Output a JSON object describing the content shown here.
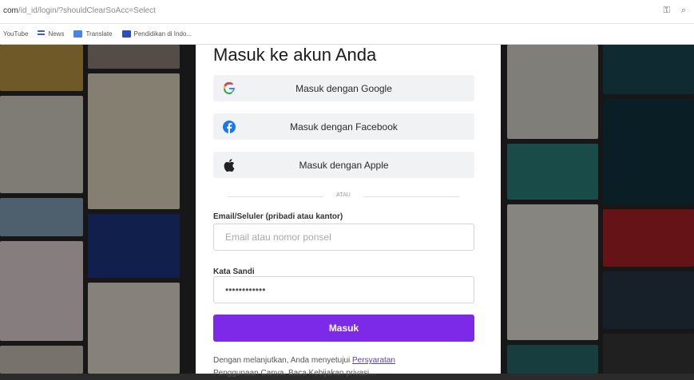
{
  "browser": {
    "url_domain": "com",
    "url_path": "/id_id/login/?shouldClearSoAcc=Select",
    "bookmarks": [
      {
        "icon": "youtube-icon",
        "label": "YouTube"
      },
      {
        "icon": "list-icon",
        "label": "News"
      },
      {
        "icon": "translate-icon",
        "label": "Translate"
      },
      {
        "icon": "ikon-icon",
        "label": "Pendidikan di Indo..."
      }
    ]
  },
  "login": {
    "title": "Masuk ke akun Anda",
    "google_label": "Masuk dengan Google",
    "facebook_label": "Masuk dengan Facebook",
    "apple_label": "Masuk dengan Apple",
    "divider_text": "ATAU",
    "email_label": "Email/Seluler (pribadi atau kantor)",
    "email_placeholder": "Email atau nomor ponsel",
    "password_label": "Kata Sandi",
    "password_value": "••••••••••••",
    "submit_label": "Masuk",
    "terms_prefix": "Dengan melanjutkan, Anda menyetujui ",
    "terms_link": "Persyaratan",
    "terms_suffix": "Penggunaan Canva. Baca Kebijakan privasi..."
  },
  "colors": {
    "accent": "#7d2ae8",
    "google_blue": "#4285f4",
    "facebook_blue": "#1877f2"
  }
}
